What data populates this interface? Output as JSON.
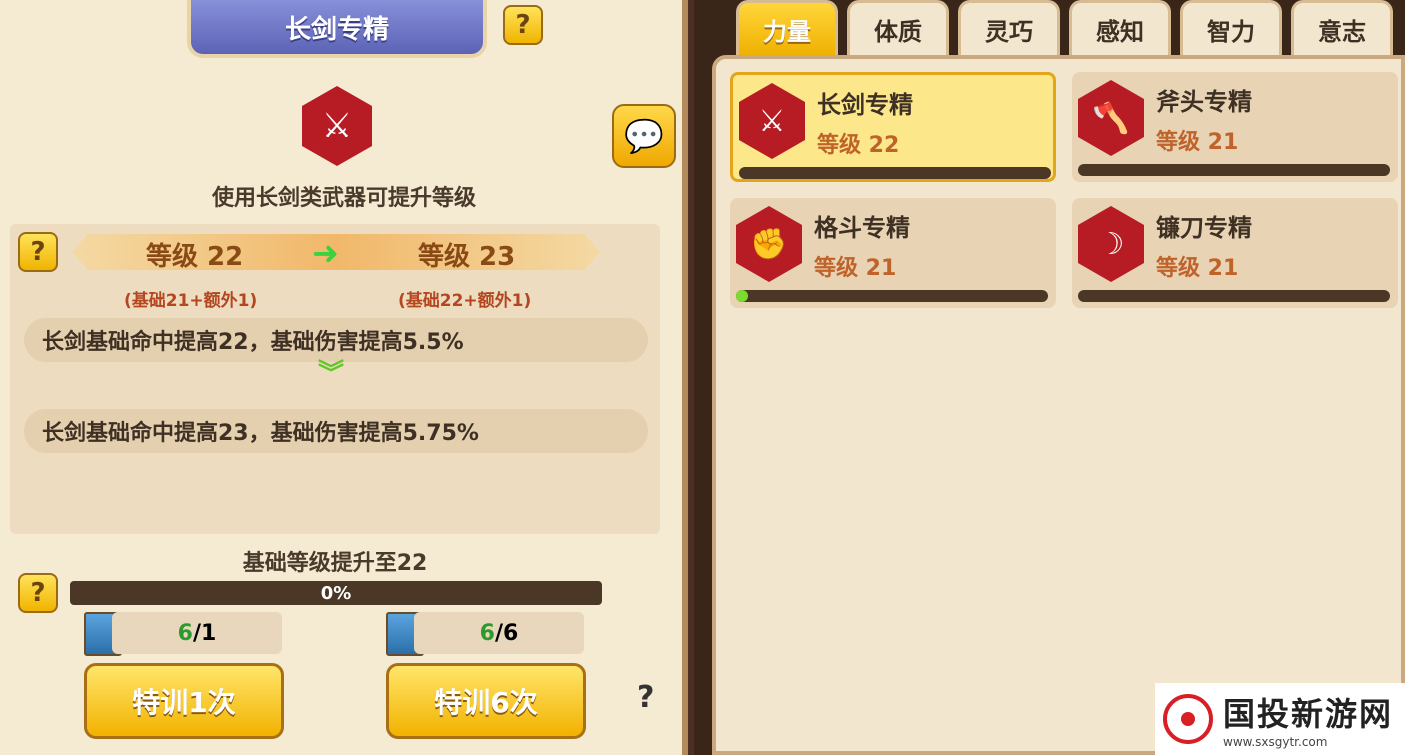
{
  "left": {
    "title": "长剑专精",
    "description": "使用长剑类武器可提升等级",
    "current_level": "等级 22",
    "next_level": "等级 23",
    "current_breakdown": "(基础21+额外1)",
    "next_breakdown": "(基础22+额外1)",
    "current_effect": "长剑基础命中提高22，基础伤害提高5.5%",
    "next_effect": "长剑基础命中提高23，基础伤害提高5.75%",
    "basic_level_text": "基础等级提升至22",
    "progress": "0%",
    "count1_have": "6",
    "count1_need": "/1",
    "count2_have": "6",
    "count2_need": "/6",
    "train1": "特训1次",
    "train6": "特训6次",
    "help": "?"
  },
  "tabs": [
    "力量",
    "体质",
    "灵巧",
    "感知",
    "智力",
    "意志"
  ],
  "skills": [
    {
      "name": "长剑专精",
      "level": "等级 22",
      "icon": "sword-icon",
      "progress": 0
    },
    {
      "name": "斧头专精",
      "level": "等级 21",
      "icon": "axe-icon",
      "progress": 0
    },
    {
      "name": "格斗专精",
      "level": "等级 21",
      "icon": "fist-icon",
      "progress": 0.02
    },
    {
      "name": "镰刀专精",
      "level": "等级 21",
      "icon": "scythe-icon",
      "progress": 0
    }
  ],
  "watermark": {
    "title": "国投新游网",
    "url": "www.sxsgytr.com"
  }
}
